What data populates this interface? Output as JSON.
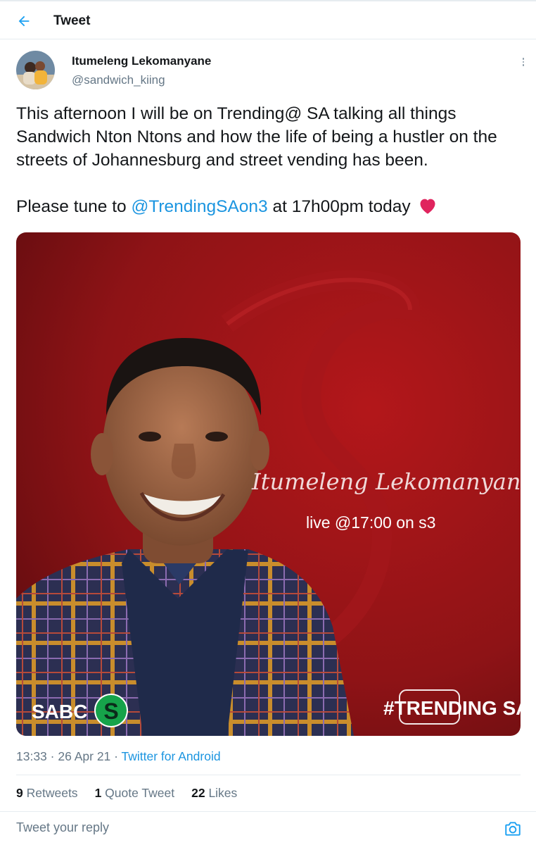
{
  "header": {
    "title": "Tweet",
    "back_icon": "arrow-left-icon",
    "accent": "#1da1f2"
  },
  "author": {
    "name": "Itumeleng Lekomanyane",
    "handle": "@sandwich_kiing"
  },
  "tweet": {
    "text_p1": "This afternoon I will be on Trending@ SA talking all things Sandwich Nton Ntons and how the life of being a hustler on the streets of Johannesburg and street vending has been.",
    "text_p2_before": "Please tune to ",
    "mention": "@TrendingSAon3",
    "text_p2_after": " at 17h00pm today",
    "emoji": "red-heart-icon"
  },
  "media": {
    "signature": "Itumeleng Lekomanyane",
    "subtitle": "live @17:00 on s3",
    "left_logo": "SABC",
    "right_logo": "#TRENDING SA"
  },
  "meta": {
    "time": "13:33",
    "separator": " · ",
    "date": "26 Apr 21",
    "source": "Twitter for Android"
  },
  "stats": {
    "retweets_count": "9",
    "retweets_label": "Retweets",
    "quotes_count": "1",
    "quotes_label": "Quote Tweet",
    "likes_count": "22",
    "likes_label": "Likes"
  },
  "reply": {
    "placeholder": "Tweet your reply",
    "icon": "camera-icon"
  }
}
